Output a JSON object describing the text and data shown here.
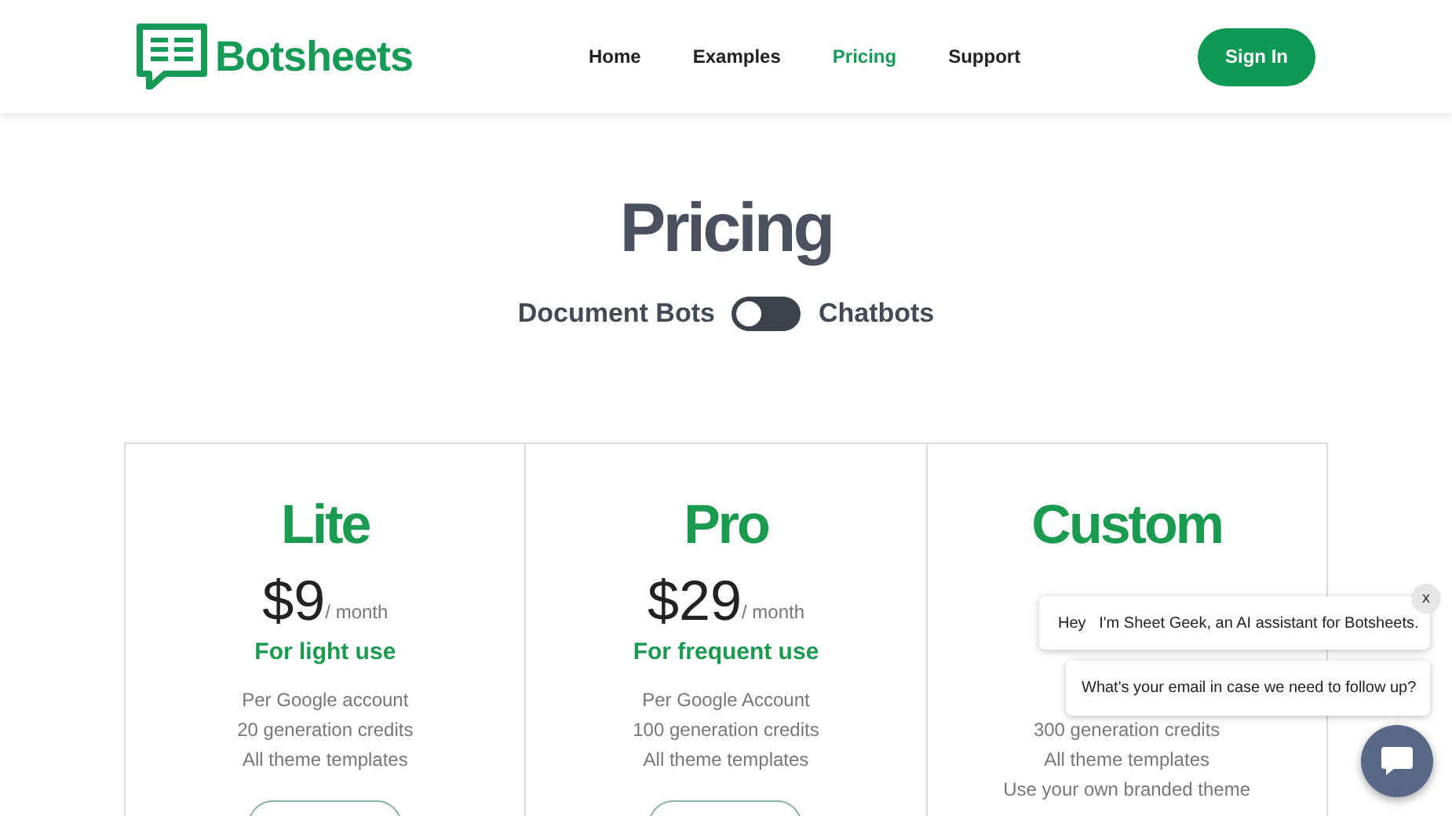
{
  "header": {
    "brand": "Botsheets",
    "nav": [
      {
        "label": "Home",
        "selected": false
      },
      {
        "label": "Examples",
        "selected": false
      },
      {
        "label": "Pricing",
        "selected": true
      },
      {
        "label": "Support",
        "selected": false
      }
    ],
    "sign_in": "Sign In"
  },
  "title": "Pricing",
  "toggle": {
    "left": "Document Bots",
    "right": "Chatbots",
    "on": false
  },
  "plans": [
    {
      "name": "Lite",
      "price": "$9",
      "period": "/ month",
      "tagline": "For light use",
      "features": [
        "Per Google account",
        "20 generation credits",
        "All theme templates"
      ]
    },
    {
      "name": "Pro",
      "price": "$29",
      "period": "/ month",
      "tagline": "For frequent use",
      "features": [
        "Per Google Account",
        "100 generation credits",
        "All theme templates"
      ]
    },
    {
      "name": "Custom",
      "features": [
        "300 generation credits",
        "All theme templates",
        "Use your own branded theme"
      ]
    }
  ],
  "chat": {
    "close": "x",
    "messages": [
      "Hey   I'm Sheet Geek, an AI assistant for Botsheets.",
      "What's your email in case we need to follow up?"
    ]
  }
}
